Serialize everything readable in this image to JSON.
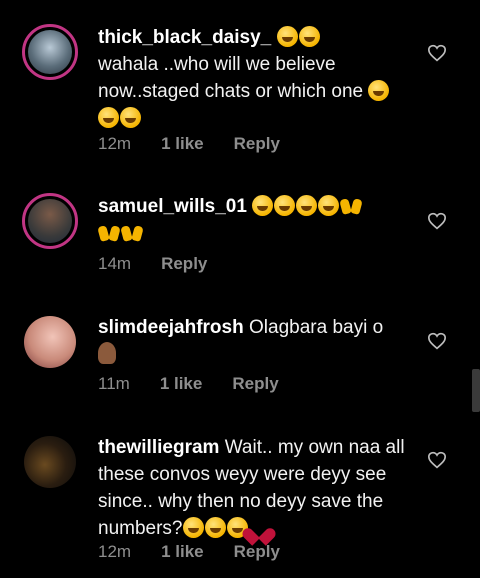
{
  "comments": [
    {
      "username": "thick_black_daisy_",
      "text_after_name": " 🤣🤣",
      "text": "wahala ..who will we believe now..staged chats or which one",
      "time": "12m",
      "likes": "1 like",
      "reply": "Reply"
    },
    {
      "username": "samuel_wills_01",
      "text": "",
      "time": "14m",
      "likes": "",
      "reply": "Reply"
    },
    {
      "username": "slimdeejahfrosh",
      "text": "Olagbara bayi o",
      "time": "11m",
      "likes": "1 like",
      "reply": "Reply"
    },
    {
      "username": "thewilliegram",
      "text": "Wait.. my own naa all these convos weyy were deyy see since.. why then no deyy save the numbers?",
      "time": "12m",
      "likes": "1 like",
      "reply": "Reply"
    }
  ],
  "colors": {
    "ring": "#c13584",
    "meta": "#8e8e8e"
  }
}
